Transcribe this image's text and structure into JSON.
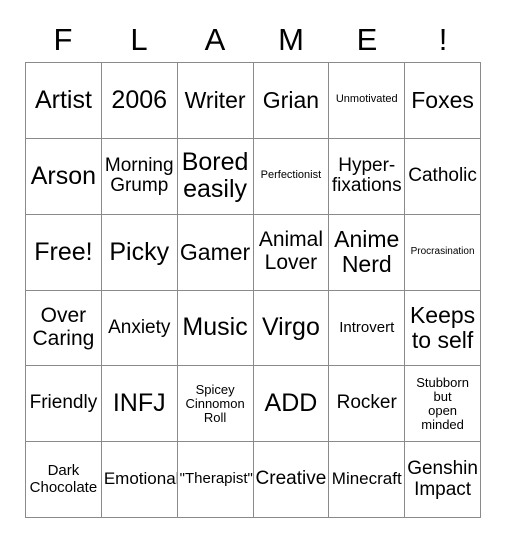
{
  "card": {
    "title_letters": [
      "F",
      "L",
      "A",
      "M",
      "E",
      "!"
    ],
    "colors": {
      "border": "#8a8a8a",
      "background": "#ffffff",
      "text": "#000000"
    },
    "rows": [
      [
        {
          "text": "Artist",
          "size": "t-xxl"
        },
        {
          "text": "2006",
          "size": "t-xxl"
        },
        {
          "text": "Writer",
          "size": "t-xl"
        },
        {
          "text": "Grian",
          "size": "t-xl"
        },
        {
          "text": "Unmotivated",
          "size": "t-tiny"
        },
        {
          "text": "Foxes",
          "size": "t-xl"
        }
      ],
      [
        {
          "text": "Arson",
          "size": "t-xxl"
        },
        {
          "text": "Morning\nGrump",
          "size": "t-md"
        },
        {
          "text": "Bored\neasily",
          "size": "t-xxl"
        },
        {
          "text": "Perfectionist",
          "size": "t-tiny"
        },
        {
          "text": "Hyper-\nfixations",
          "size": "t-md"
        },
        {
          "text": "Catholic",
          "size": "t-md"
        }
      ],
      [
        {
          "text": "Free!",
          "size": "t-xxl"
        },
        {
          "text": "Picky",
          "size": "t-xxl"
        },
        {
          "text": "Gamer",
          "size": "t-xl"
        },
        {
          "text": "Animal\nLover",
          "size": "t-lg"
        },
        {
          "text": "Anime\nNerd",
          "size": "t-xl"
        },
        {
          "text": "Procrasination",
          "size": "t-micro"
        }
      ],
      [
        {
          "text": "Over\nCaring",
          "size": "t-lg"
        },
        {
          "text": "Anxiety",
          "size": "t-md"
        },
        {
          "text": "Music",
          "size": "t-xxl"
        },
        {
          "text": "Virgo",
          "size": "t-xxl"
        },
        {
          "text": "Introvert",
          "size": "t-xs"
        },
        {
          "text": "Keeps\nto self",
          "size": "t-xl"
        }
      ],
      [
        {
          "text": "Friendly",
          "size": "t-md"
        },
        {
          "text": "INFJ",
          "size": "t-xxl"
        },
        {
          "text": "Spicey\nCinnomon\nRoll",
          "size": "t-xxs"
        },
        {
          "text": "ADD",
          "size": "t-xxl"
        },
        {
          "text": "Rocker",
          "size": "t-md"
        },
        {
          "text": "Stubborn\nbut\nopen\nminded",
          "size": "t-xxs"
        }
      ],
      [
        {
          "text": "Dark\nChocolate",
          "size": "t-xs"
        },
        {
          "text": "Emotional",
          "size": "t-sm"
        },
        {
          "text": "\"Therapist\"",
          "size": "t-xs"
        },
        {
          "text": "Creative",
          "size": "t-md"
        },
        {
          "text": "Minecraft",
          "size": "t-sm"
        },
        {
          "text": "Genshin\nImpact",
          "size": "t-md"
        }
      ]
    ]
  }
}
